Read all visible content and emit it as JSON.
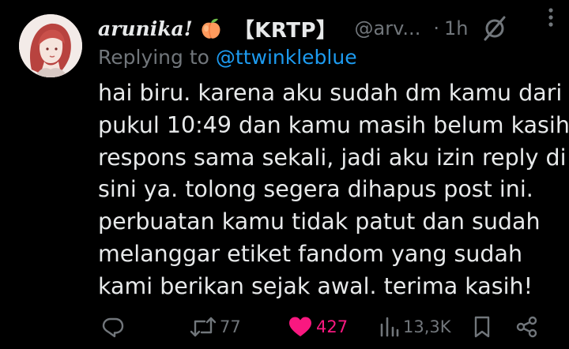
{
  "tweet": {
    "display_name": "arunika!",
    "name_emoji": "peach-emoji",
    "krtp": "【KRTP】",
    "handle": "@arv...",
    "dot": "·",
    "time": "1h",
    "replying_prefix": "Replying to",
    "replying_to": "@ttwinkleblue",
    "body_lines": [
      "hai biru. karena aku sudah dm kamu dari",
      "pukul 10:49 dan kamu masih belum kasih",
      "respons sama sekali, jadi aku izin reply di",
      "sini ya. tolong segera dihapus post ini.",
      "perbuatan kamu tidak patut dan sudah",
      "melanggar etiket fandom yang sudah",
      "kami berikan sejak awal. terima kasih!"
    ]
  },
  "actions": {
    "reply_icon": "reply-icon",
    "retweet_count": "77",
    "like_count": "427",
    "view_count": "13,3K",
    "bookmark_icon": "bookmark-icon",
    "share_icon": "share-icon",
    "like_color": "#f91880"
  },
  "colors": {
    "background": "#000000",
    "text": "#e7e9ea",
    "muted": "#71767b",
    "link": "#1d9bf0",
    "like": "#f91880"
  }
}
